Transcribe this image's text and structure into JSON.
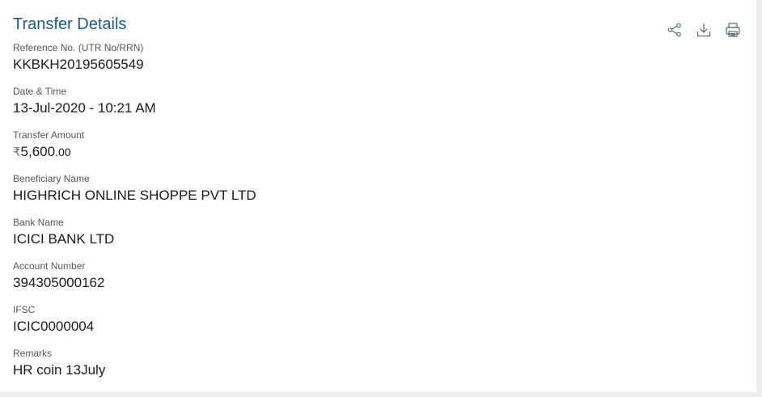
{
  "header": {
    "title": "Transfer Details",
    "actions": [
      {
        "icon": "share-icon"
      },
      {
        "icon": "download-icon"
      },
      {
        "icon": "print-icon"
      }
    ]
  },
  "fields": {
    "reference": {
      "label": "Reference No. (UTR No/RRN)",
      "value": "KKBKH20195605549"
    },
    "datetime": {
      "label": "Date & Time",
      "value": "13-Jul-2020 - 10:21 AM"
    },
    "amount": {
      "label": "Transfer Amount",
      "currency_symbol": "₹",
      "whole": "5,600",
      "decimal": ".00"
    },
    "beneficiary": {
      "label": "Beneficiary Name",
      "value": "HIGHRICH ONLINE SHOPPE PVT LTD"
    },
    "bank": {
      "label": "Bank Name",
      "value": "ICICI BANK LTD"
    },
    "account": {
      "label": "Account Number",
      "value": "394305000162"
    },
    "ifsc": {
      "label": "IFSC",
      "value": "ICIC0000004"
    },
    "remarks": {
      "label": "Remarks",
      "value": "HR coin 13July"
    }
  },
  "colors": {
    "title": "#1e5a8c",
    "label": "#555555",
    "value": "#1a1a1a",
    "icon": "#5a6570"
  }
}
